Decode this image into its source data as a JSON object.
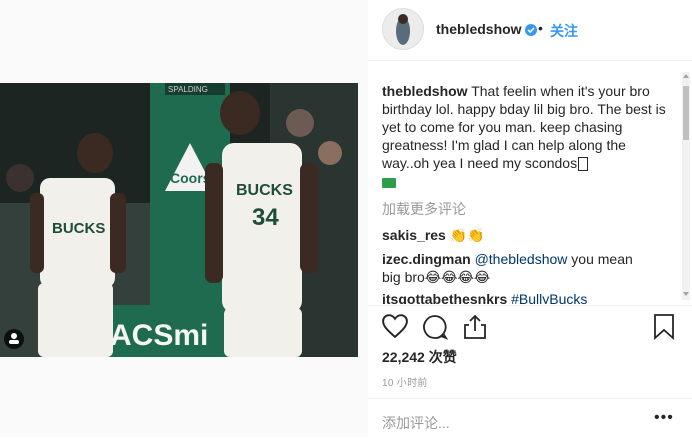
{
  "post": {
    "username": "thebledshow",
    "follow_label": "关注",
    "separator": "•",
    "caption_user": "thebledshow",
    "caption_text": "That feelin when it's your bro birthday lol. happy bday lil big bro. The best is yet to come for you man. keep chasing greatness! I'm glad I can help along the way..oh yea I need my scondos",
    "caption_tail_emoji": "money-with-wings-icon",
    "load_more": "加载更多评论",
    "comments": [
      {
        "user": "sakis_res",
        "text": "👏👏"
      },
      {
        "user": "izec.dingman",
        "mention": "@thebledshow",
        "text": "you mean big bro😂😂😂😂"
      },
      {
        "user": "itsgottabethesnkrs",
        "tag": "#BullyBucks",
        "text": ""
      }
    ],
    "likes": "22,242 次赞",
    "time": "10 小时前",
    "add_comment_placeholder": "添加评论...",
    "more_label": "•••"
  },
  "photo": {
    "jersey_left": "BUCKS",
    "jersey_right": "BUCKS",
    "number_right": "34",
    "banner_text": "Coors LIGHT",
    "court_text": "ACSmi",
    "scoreboard": "SPALDING"
  },
  "colors": {
    "accent": "#3897f0",
    "link": "#003569",
    "muted": "#999999"
  }
}
